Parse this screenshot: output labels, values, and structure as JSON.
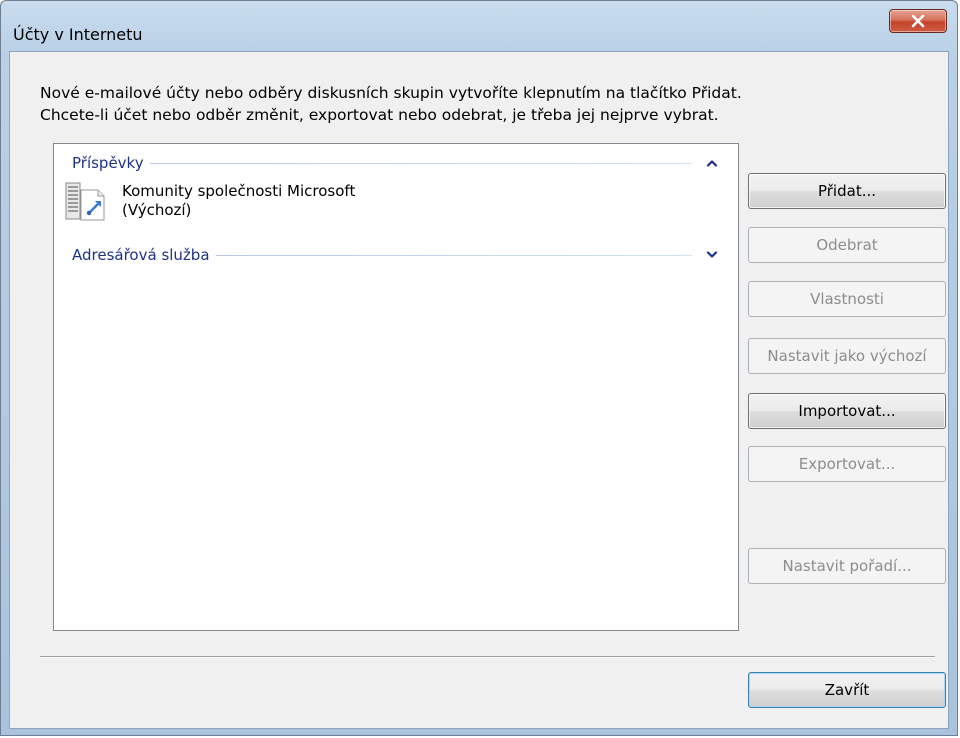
{
  "window": {
    "title": "Účty v Internetu",
    "close_label": "X"
  },
  "instructions": {
    "line1": "Nové e-mailové účty nebo odběry diskusních skupin vytvoříte klepnutím na tlačítko Přidat.",
    "line2": "Chcete-li účet nebo odběr změnit, exportovat nebo odebrat, je třeba jej nejprve vybrat."
  },
  "groups": [
    {
      "label": "Příspěvky",
      "state": "expanded",
      "chevron": "chevron-up-icon",
      "items": [
        {
          "name": "Komunity společnosti Microsoft",
          "status": "(Výchozí)",
          "icon": "news-server-icon"
        }
      ]
    },
    {
      "label": "Adresářová služba",
      "state": "collapsed",
      "chevron": "chevron-down-icon",
      "items": []
    }
  ],
  "buttons": {
    "add": {
      "label": "Přidat...",
      "enabled": true
    },
    "remove": {
      "label": "Odebrat",
      "enabled": false
    },
    "properties": {
      "label": "Vlastnosti",
      "enabled": false
    },
    "set_default": {
      "label": "Nastavit jako výchozí",
      "enabled": false
    },
    "import": {
      "label": "Importovat...",
      "enabled": true
    },
    "export": {
      "label": "Exportovat...",
      "enabled": false
    },
    "set_order": {
      "label": "Nastavit pořadí...",
      "enabled": false
    },
    "close": {
      "label": "Zavřít",
      "enabled": true
    }
  },
  "colors": {
    "group_header": "#1e3287",
    "disabled_text": "#8d8d8d",
    "close_button": "#c4432b"
  }
}
